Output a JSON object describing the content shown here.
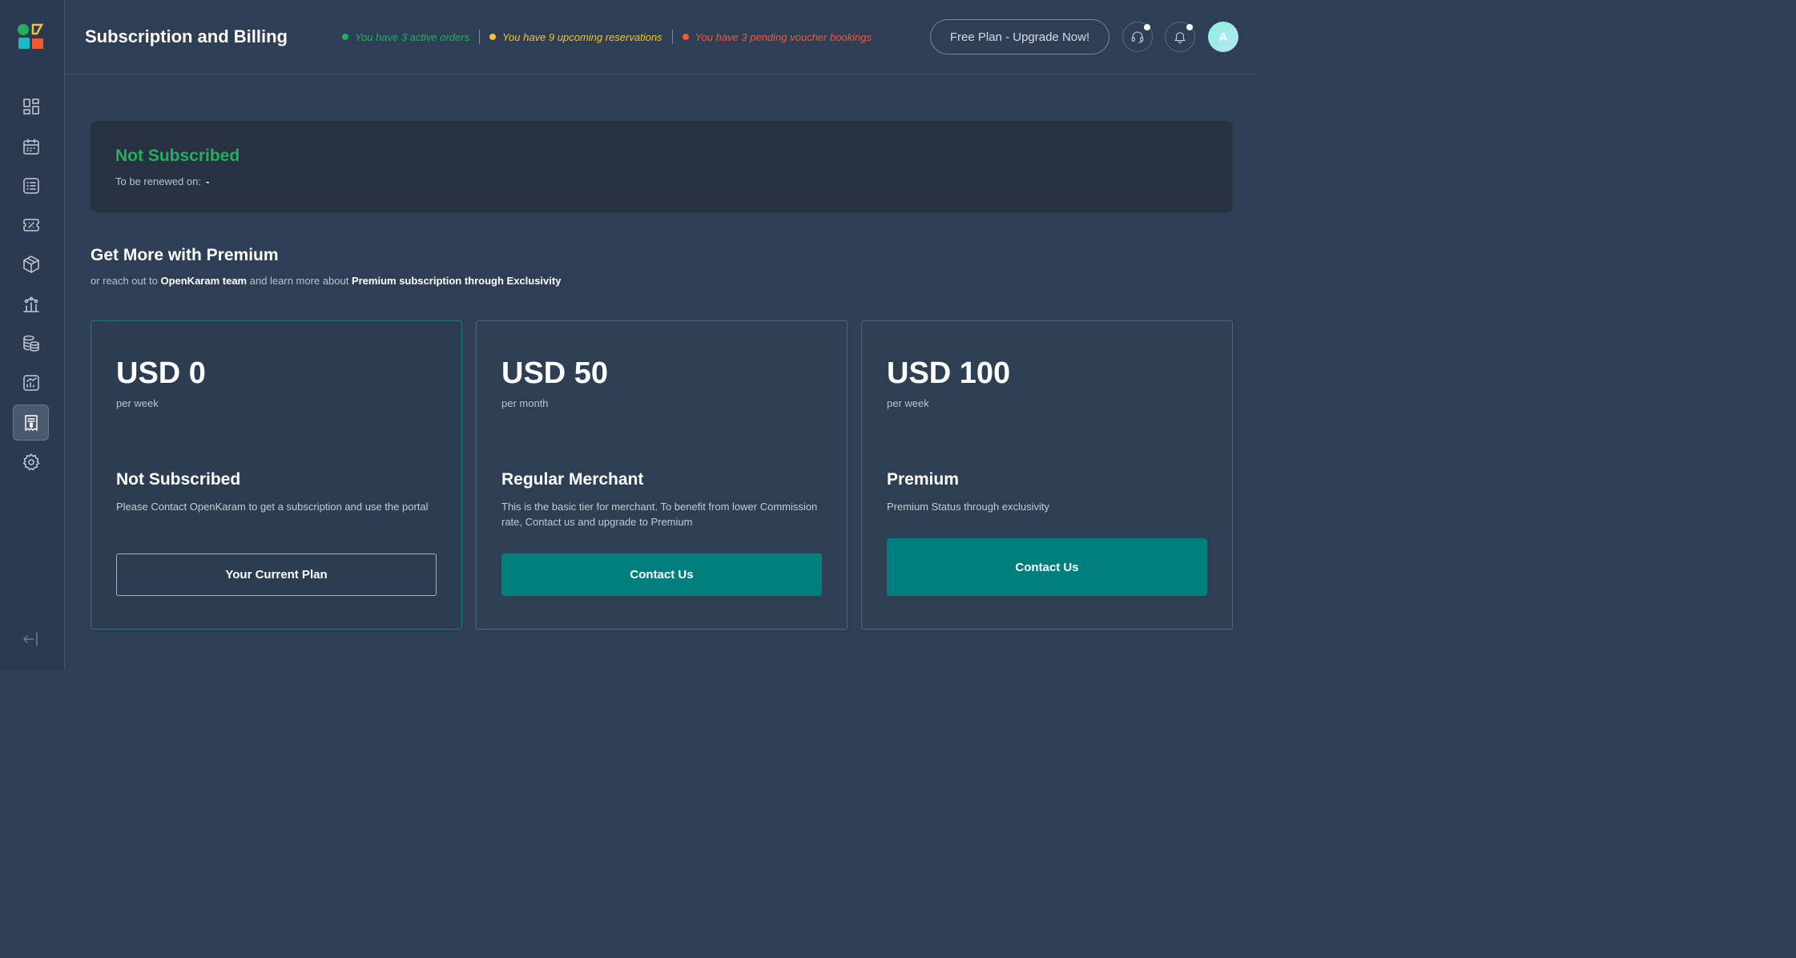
{
  "header": {
    "title": "Subscription and Billing",
    "notices": [
      {
        "text": "You have 3 active orders",
        "color": "#20b15a"
      },
      {
        "text": "You have 9 upcoming reservations",
        "color": "#f2c230"
      },
      {
        "text": "You have 3 pending voucher bookings",
        "color": "#ef5a35"
      }
    ],
    "upgrade_label": "Free Plan - Upgrade Now!",
    "avatar_initial": "A"
  },
  "sidebar": {
    "items": [
      {
        "icon": "dashboard-icon"
      },
      {
        "icon": "calendar-icon"
      },
      {
        "icon": "list-icon"
      },
      {
        "icon": "voucher-icon"
      },
      {
        "icon": "box-icon"
      },
      {
        "icon": "analytics-icon"
      },
      {
        "icon": "database-icon"
      },
      {
        "icon": "reports-icon"
      },
      {
        "icon": "billing-icon",
        "active": true
      },
      {
        "icon": "settings-icon"
      }
    ],
    "logout_icon": "logout-icon"
  },
  "status": {
    "title": "Not Subscribed",
    "renew_label": "To be renewed on:",
    "renew_value": "-"
  },
  "premium": {
    "title": "Get More with Premium",
    "sub_prefix": "or reach out to",
    "sub_team": "OpenKaram team",
    "sub_middle": "and learn more about",
    "sub_highlight": "Premium subscription through Exclusivity"
  },
  "plans": [
    {
      "price": "USD 0",
      "period": "per week",
      "name": "Not Subscribed",
      "description": "Please Contact OpenKaram to get a subscription and use the portal",
      "button": "Your Current Plan"
    },
    {
      "price": "USD 50",
      "period": "per month",
      "name": "Regular Merchant",
      "description": "This is the basic tier for merchant. To benefit from lower Commission rate, Contact us and upgrade to Premium",
      "button": "Contact Us"
    },
    {
      "price": "USD 100",
      "period": "per week",
      "name": "Premium",
      "description": "Premium Status through exclusivity",
      "button": "Contact Us"
    }
  ],
  "colors": {
    "accent": "#007f7f",
    "success": "#20b15a",
    "warning": "#f2c230",
    "danger": "#ef5a35"
  }
}
